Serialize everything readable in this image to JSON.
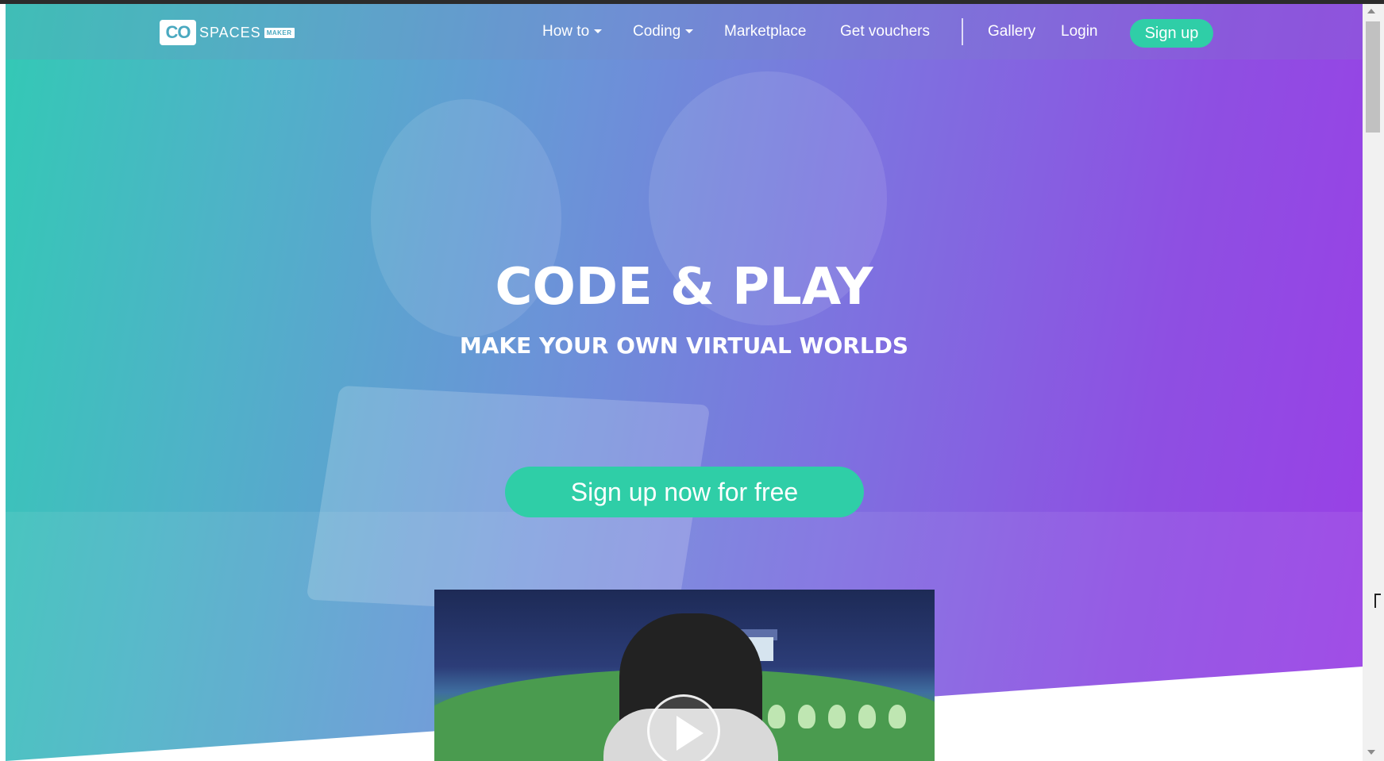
{
  "brand": {
    "logo_mark": "CO",
    "logo_word": "SPACES",
    "logo_tag": "MAKER"
  },
  "nav": {
    "howto_label": "How to",
    "coding_label": "Coding",
    "marketplace_label": "Marketplace",
    "vouchers_label": "Get vouchers",
    "gallery_label": "Gallery",
    "login_label": "Login",
    "signup_label": "Sign up"
  },
  "hero": {
    "headline": "CODE & PLAY",
    "subheadline": "MAKE YOUR OWN VIRTUAL WORLDS",
    "cta_label": "Sign up now for free"
  },
  "colors": {
    "accent_green": "#2fcea7",
    "gradient_start": "#33c9b5",
    "gradient_end": "#9a3fe6"
  },
  "icons": {
    "dropdown": "caret-down-icon",
    "play": "play-icon"
  }
}
